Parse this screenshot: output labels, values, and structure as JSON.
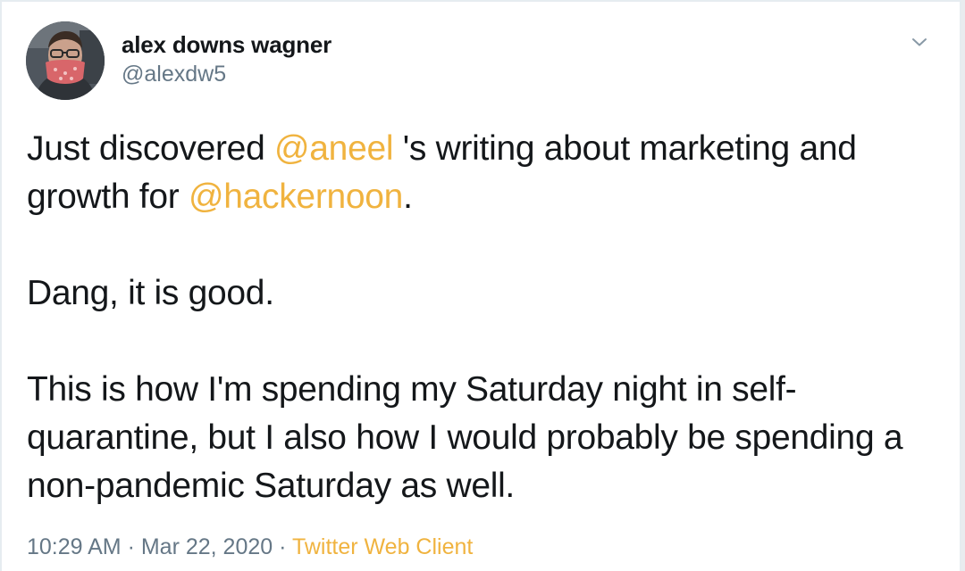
{
  "author": {
    "display_name": "alex downs wagner",
    "handle": "@alexdw5",
    "avatar_icon": "profile-photo-avatar"
  },
  "menu": {
    "icon": "chevron-down-icon"
  },
  "tweet": {
    "paragraph1": {
      "before": "Just discovered ",
      "mention1": "@aneel",
      "middle": " 's writing about marketing and growth for ",
      "mention2": "@hackernoon",
      "after": "."
    },
    "paragraph2": "Dang, it is good.",
    "paragraph3": "This is how I'm spending my Saturday night in self-quarantine, but I also how I would probably be spending a non-pandemic Saturday as well."
  },
  "meta": {
    "time": "10:29 AM",
    "separator1": " · ",
    "date": "Mar 22, 2020",
    "separator2": " · ",
    "source": "Twitter Web Client"
  },
  "colors": {
    "accent": "#f0b33f",
    "text": "#14171a",
    "secondary": "#657786",
    "border": "#e6ecf0"
  }
}
